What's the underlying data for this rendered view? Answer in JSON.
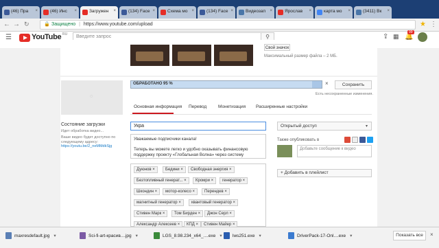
{
  "browser": {
    "tabs": [
      {
        "label": "(46) Пра",
        "color": "#3b5998"
      },
      {
        "label": "(46) Инс",
        "color": "#e52d27"
      },
      {
        "label": "Загружен",
        "color": "#e52d27",
        "active": true
      },
      {
        "label": "(134) Face",
        "color": "#3b5998"
      },
      {
        "label": "Схема мо",
        "color": "#e52d27"
      },
      {
        "label": "(134) Face",
        "color": "#3b5998"
      },
      {
        "label": "Видеозап",
        "color": "#4a76a8"
      },
      {
        "label": "Ярослав",
        "color": "#e52d27"
      },
      {
        "label": "карта мо",
        "color": "#4285f4"
      },
      {
        "label": "(3411) Вк",
        "color": "#4a76a8"
      }
    ],
    "address": {
      "secure_label": "Защищено",
      "url": "https://www.youtube.com/upload"
    }
  },
  "youtube": {
    "logo_text": "YouTube",
    "logo_suffix": "RU",
    "search_placeholder": "Введите запрос",
    "notif_count": "99"
  },
  "upload": {
    "badge_button": "Свой значок",
    "max_size_note": "Максимальный размер файла – 2 МБ.",
    "progress_label": "ОБРАБОТАНО 95 %",
    "progress_percent": 95,
    "save_button": "Сохранить",
    "saved_note": "Есть несохраненные изменения.",
    "tabs": [
      "Основная информация",
      "Перевод",
      "Монетизация",
      "Расширенные настройки"
    ],
    "status_title": "Состояние загрузки",
    "status_text": "Идет обработка видео...",
    "status_help": "Ваше видео будет доступно по следующему адресу:",
    "status_link": "https://youtu.be/2_neMMdkSjg",
    "title_value": "Укра",
    "description": "Уважаемые подписчики канала!\n\nТеперь вы можете легко и удобно оказывать финансовую поддержку проекту «Глобальная Волна» через систему",
    "tags": [
      "Дуюнов",
      "Бедини",
      "Свободная энергия",
      "Безтопливный генерат...",
      "Кромри",
      "генератор",
      "Шкондин",
      "мотор-колесо",
      "Перендев",
      "магнитный генератор",
      "квантовый генератор",
      "Стивен Марк",
      "Том Бирден",
      "Джон Серл",
      "Александр Алексеев",
      "КПД",
      "Стивен Майер"
    ],
    "privacy": "Открытый доступ",
    "publish_label": "Также опубликовать в",
    "comment_placeholder": "Добавьте сообщение к видео",
    "add_playlist": "+ Добавить в плейлист"
  },
  "downloads": {
    "items": [
      {
        "name": "maxresdefault.jpg",
        "color": "#5a7fb5"
      },
      {
        "name": "Sci-fi-art-красив....jpg",
        "color": "#7b5aa5"
      },
      {
        "name": "LGS_8.98.234_x64_....exe",
        "color": "#3a8a3a"
      },
      {
        "name": "lws251.exe",
        "color": "#2a5db0"
      },
      {
        "name": "DriverPack-17-Onl....exe",
        "color": "#3b7bd0"
      }
    ],
    "show_all": "Показать все"
  }
}
